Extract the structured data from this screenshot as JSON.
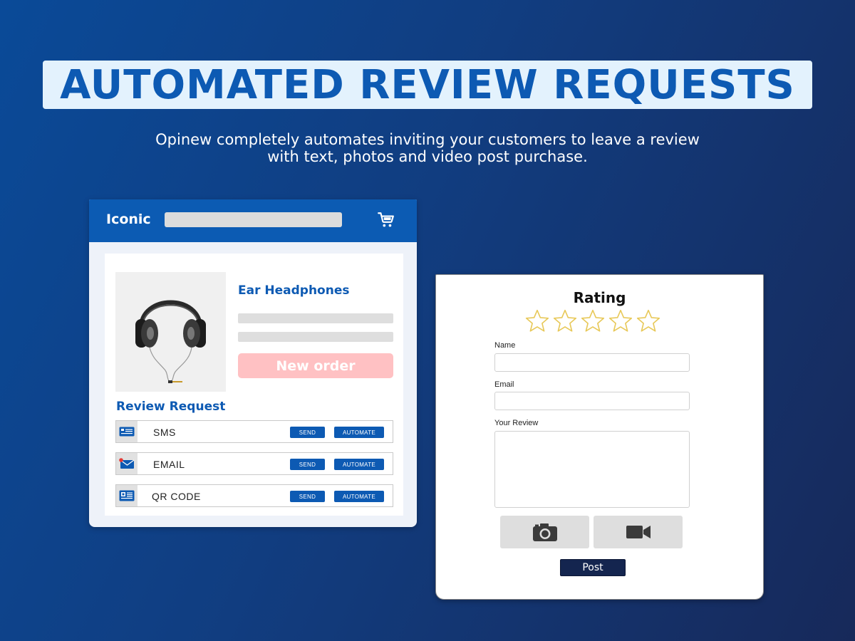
{
  "headline": "AUTOMATED REVIEW REQUESTS",
  "subtitle": {
    "line1": "Opinew completely automates inviting your customers to leave a review",
    "line2": "with text, photos and video post purchase."
  },
  "store": {
    "brand": "Iconic",
    "cart_icon": "shopping-cart-icon",
    "product": {
      "name": "Ear Headphones",
      "image_icon": "headphones-icon",
      "new_order_label": "New order"
    },
    "review_request": {
      "title": "Review Request",
      "channels": [
        {
          "label": "SMS",
          "icon": "sms-icon",
          "send_label": "SEND",
          "automate_label": "AUTOMATE"
        },
        {
          "label": "EMAIL",
          "icon": "email-icon",
          "send_label": "SEND",
          "automate_label": "AUTOMATE"
        },
        {
          "label": "QR CODE",
          "icon": "qr-code-icon",
          "send_label": "SEND",
          "automate_label": "AUTOMATE"
        }
      ]
    }
  },
  "review_form": {
    "rating_title": "Rating",
    "rating_value": 0,
    "rating_max": 5,
    "name_label": "Name",
    "name_value": "",
    "email_label": "Email",
    "email_value": "",
    "review_label": "Your Review",
    "review_value": "",
    "photo_icon": "camera-icon",
    "video_icon": "video-camera-icon",
    "post_label": "Post"
  },
  "colors": {
    "brand_blue": "#0c5bb3",
    "headline_bg": "#e3f2fd",
    "new_order_pink": "#ffc1c3",
    "post_navy": "#14254f",
    "star_outline": "#e8c95a"
  }
}
